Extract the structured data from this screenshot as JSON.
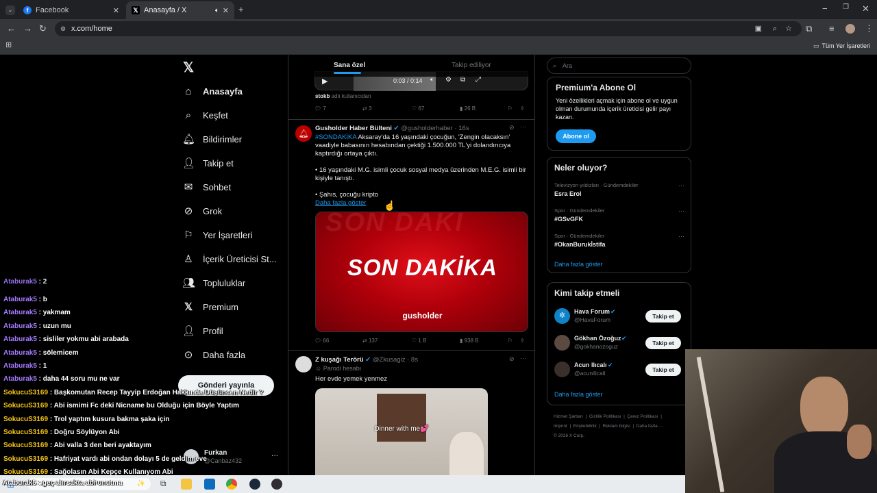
{
  "browser": {
    "tabs": [
      {
        "title": "Facebook",
        "icon": "facebook-icon"
      },
      {
        "title": "Anasayfa / X",
        "icon": "x-logo-icon"
      }
    ],
    "url": "x.com/home",
    "bookmarks_label": "Tüm Yer İşaretleri"
  },
  "nav": {
    "items": [
      {
        "label": "Anasayfa",
        "icon": "home-icon"
      },
      {
        "label": "Keşfet",
        "icon": "search-icon"
      },
      {
        "label": "Bildirimler",
        "icon": "bell-icon"
      },
      {
        "label": "Takip et",
        "icon": "follow-icon"
      },
      {
        "label": "Sohbet",
        "icon": "mail-icon"
      },
      {
        "label": "Grok",
        "icon": "grok-icon"
      },
      {
        "label": "Yer İşaretleri",
        "icon": "bookmark-icon"
      },
      {
        "label": "İçerik Üreticisi St...",
        "icon": "creator-icon"
      },
      {
        "label": "Topluluklar",
        "icon": "communities-icon"
      },
      {
        "label": "Premium",
        "icon": "x-premium-icon"
      },
      {
        "label": "Profil",
        "icon": "profile-icon"
      },
      {
        "label": "Daha fazla",
        "icon": "more-circle-icon"
      }
    ],
    "post_button": "Gönderi yayınla",
    "account": {
      "name": "Furkan",
      "handle": "@Canbaz432"
    }
  },
  "feed": {
    "tabs": [
      "Sana özel",
      "Takip ediliyor"
    ],
    "video": {
      "time": "0:03 / 0:14",
      "caption_user": "stokb",
      "caption_rest": "adlı kullanıcıdan"
    },
    "video_stats": {
      "replies": "7",
      "reposts": "3",
      "likes": "67",
      "views": "26 B"
    },
    "tweet1": {
      "name": "Gusholder Haber Bülteni",
      "handle": "@gusholderhaber · 16s",
      "hashtag": "#SONDAKİKA",
      "text1": " Aksaray'da 16 yaşındaki çocuğun, 'Zengin olacaksın' vaadiyle babasının hesabından çektiği 1.500.000 TL'yi dolandırıcıya kaptırdığı ortaya çıktı.",
      "text2": "• 16 yaşındaki M.G. isimli çocuk sosyal medya üzerinden M.E.G. isimli bir kişiyle tanıştı.",
      "text3": "• Şahıs, çocuğu kripto",
      "show_more": "Daha fazla göster",
      "image_title": "SON DAKİKA",
      "image_watermark": "gusholder",
      "stats": {
        "replies": "66",
        "reposts": "137",
        "likes": "1 B",
        "views": "938 B"
      }
    },
    "tweet2": {
      "name": "Z kuşağı Terörü",
      "handle": "@Zkusagiz · 8s",
      "label": "Parodi hesabı",
      "text": "Her evde yemek yenmez",
      "video_caption": "Dinner with me💕"
    }
  },
  "right": {
    "search_placeholder": "Ara",
    "premium": {
      "title": "Premium'a Abone Ol",
      "text": "Yeni özellikleri açmak için abone ol ve uygun olman durumunda içerik üreticisi gelir payı kazan.",
      "button": "Abone ol"
    },
    "trends": {
      "title": "Neler oluyor?",
      "items": [
        {
          "context": "Televizyon yıldızları · Gündemdekiler",
          "name": "Esra Erol"
        },
        {
          "context": "Spor · Gündemdekiler",
          "name": "#GSvGFK"
        },
        {
          "context": "Spor · Gündemdekiler",
          "name": "#OkanBurukİstifa"
        }
      ],
      "show_more": "Daha fazla göster"
    },
    "who_to_follow": {
      "title": "Kimi takip etmeli",
      "items": [
        {
          "name": "Hava Forum",
          "handle": "@HavaForum",
          "button": "Takip et"
        },
        {
          "name": "Gökhan Özoğuz",
          "handle": "@gokhanozoguz",
          "button": "Takip et"
        },
        {
          "name": "Acun Ilıcalı",
          "handle": "@acunilicali",
          "button": "Takip et"
        }
      ],
      "show_more": "Daha fazla göster"
    },
    "footer": {
      "links": [
        "Hizmet Şartları",
        "Gizlilik Politikası",
        "Çerez Politikası",
        "Imprint",
        "Erişilebilirlik",
        "Reklam bilgisi",
        "Daha fazla ···"
      ],
      "copyright": "© 2026 X Corp."
    }
  },
  "chat": {
    "lines": [
      {
        "user": "Ataburak5",
        "msg": " : b",
        "color": "u1"
      },
      {
        "user": "Ataburak5",
        "msg": " : yakmam",
        "color": "u1"
      },
      {
        "user": "Ataburak5",
        "msg": " : uzun mu",
        "color": "u1"
      },
      {
        "user": "Ataburak5",
        "msg": " : sisliler yokmu abi arabada",
        "color": "u1"
      },
      {
        "user": "Ataburak5",
        "msg": " : sölemicem",
        "color": "u1"
      },
      {
        "user": "Ataburak5",
        "msg": " : 1",
        "color": "u1"
      },
      {
        "user": "Ataburak5",
        "msg": " : daha 44 soru mu ne var",
        "color": "u1"
      },
      {
        "user": "SokucuS3169",
        "msg": " : Başkomutan Recep Tayyip Erdoğan Hakkında Düşüncen Nedir ?",
        "color": "u2"
      },
      {
        "user": "SokucuS3169",
        "msg": " : Abi ismimi Fc deki Nicname bu Olduğu için Böyle Yaptım",
        "color": "u2"
      },
      {
        "user": "SokucuS3169",
        "msg": " : Trol yaptım kusura bakma şaka için",
        "color": "u2"
      },
      {
        "user": "SokucuS3169",
        "msg": " : Doğru Söylüyon Abi",
        "color": "u2"
      },
      {
        "user": "SokucuS3169",
        "msg": " : Abi valla 3 den beri ayaktayım",
        "color": "u2"
      },
      {
        "user": "SokucuS3169",
        "msg": " : Hafriyat vardı abi ondan dolayı 5 de geldim eve",
        "color": "u2"
      },
      {
        "user": "SokucuS3169",
        "msg": " : Sağolasın Abi Kepçe Kullanıyom Abi",
        "color": "u2"
      }
    ],
    "bottom_line": "Ataburak5 : geç alırsakta abi unutma"
  },
  "taskbar": {
    "search_label": "Ara"
  }
}
